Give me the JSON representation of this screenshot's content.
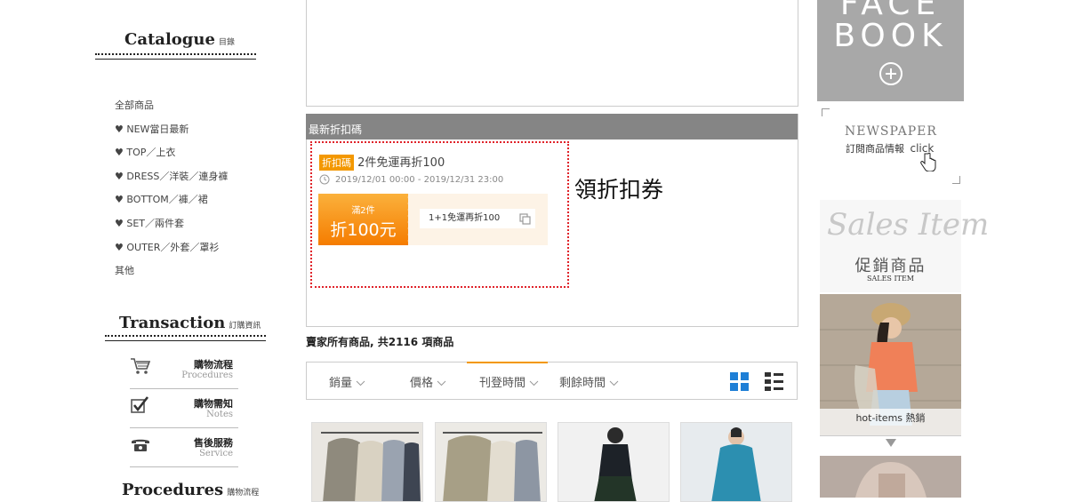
{
  "sidebar": {
    "catalogue_title": "Catalogue",
    "catalogue_sub": "目錄",
    "categories": [
      "全部商品",
      "♥ NEW當日最新",
      "♥ TOP／上衣",
      "♥ DRESS／洋裝／連身褲",
      "♥ BOTTOM／褲／裙",
      "♥ SET／兩件套",
      "♥ OUTER／外套／罩衫",
      "其他"
    ],
    "transaction_title": "Transaction",
    "transaction_sub": "訂購資訊",
    "info": [
      {
        "zh": "購物流程",
        "en": "Procedures",
        "icon": "shopping-cart-icon"
      },
      {
        "zh": "購物需知",
        "en": "Notes",
        "icon": "checkbox-check-icon"
      },
      {
        "zh": "售後服務",
        "en": "Service",
        "icon": "telephone-icon"
      }
    ],
    "procedures_title": "Procedures",
    "procedures_sub": "購物流程"
  },
  "coupon": {
    "header": "最新折扣碼",
    "tag": "折扣碼",
    "title": "2件免運再折100",
    "period": "2019/12/01 00:00 - 2019/12/31 23:00",
    "card_top": "滿2件",
    "card_big": "折100元",
    "code_text": "1+1免運再折100",
    "claim_label": "領折扣券"
  },
  "products": {
    "summary": "賣家所有商品, 共2116 項商品",
    "sort": [
      "銷量",
      "價格",
      "刊登時間",
      "剩餘時間"
    ],
    "active_sort": "刊登時間"
  },
  "right": {
    "facebook_line1": "FACE",
    "facebook_line2": "BOOK",
    "newspaper_title": "NEWSPAPER",
    "newspaper_sub": "訂閱商品情報",
    "newspaper_click": "click",
    "sales_script": "Sales Item",
    "sales_zh": "促銷商品",
    "sales_en": "SALES ITEM",
    "hot_items": "hot-items 熱銷"
  },
  "colors": {
    "accent": "#f39800",
    "dash_red": "#e0232a",
    "grid_blue": "#1e7fd6",
    "header_gray": "#858585",
    "facebook_gray": "#a8a8a8"
  }
}
